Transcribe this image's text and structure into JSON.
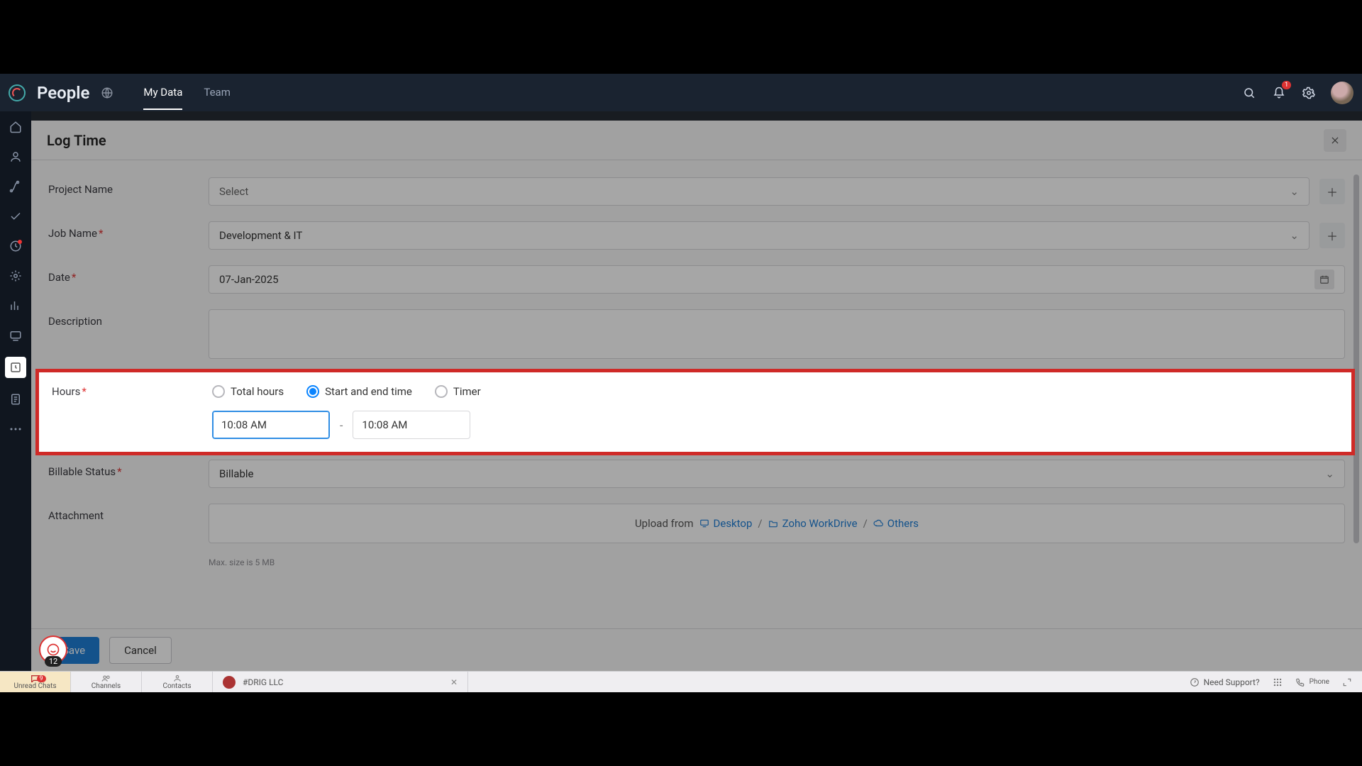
{
  "app": {
    "title": "People"
  },
  "tabs": [
    {
      "label": "My Data",
      "active": true
    },
    {
      "label": "Team",
      "active": false
    }
  ],
  "notifications": {
    "count": "1"
  },
  "panel": {
    "title": "Log Time",
    "fields": {
      "project_name": {
        "label": "Project Name",
        "value": "Select",
        "placeholder": true
      },
      "job_name": {
        "label": "Job Name",
        "value": "Development & IT"
      },
      "date": {
        "label": "Date",
        "value": "07-Jan-2025"
      },
      "description": {
        "label": "Description"
      },
      "hours": {
        "label": "Hours",
        "options": [
          {
            "key": "total",
            "label": "Total hours",
            "checked": false
          },
          {
            "key": "range",
            "label": "Start and end time",
            "checked": true
          },
          {
            "key": "timer",
            "label": "Timer",
            "checked": false
          }
        ],
        "start": "10:08 AM",
        "end": "10:08 AM"
      },
      "billable": {
        "label": "Billable Status",
        "value": "Billable"
      },
      "attachment": {
        "label": "Attachment",
        "lead": "Upload from",
        "desktop": "Desktop",
        "workdrive": "Zoho WorkDrive",
        "others": "Others",
        "hint": "Max. size is 5 MB"
      }
    },
    "buttons": {
      "save": "Save",
      "cancel": "Cancel"
    }
  },
  "chat_bubble": {
    "count": "12"
  },
  "bottom": {
    "unread": {
      "label": "Unread Chats",
      "count": "9"
    },
    "channels": "Channels",
    "contacts": "Contacts",
    "open_chat": "#DRIG LLC",
    "support": "Need Support?",
    "phone": "Phone"
  }
}
